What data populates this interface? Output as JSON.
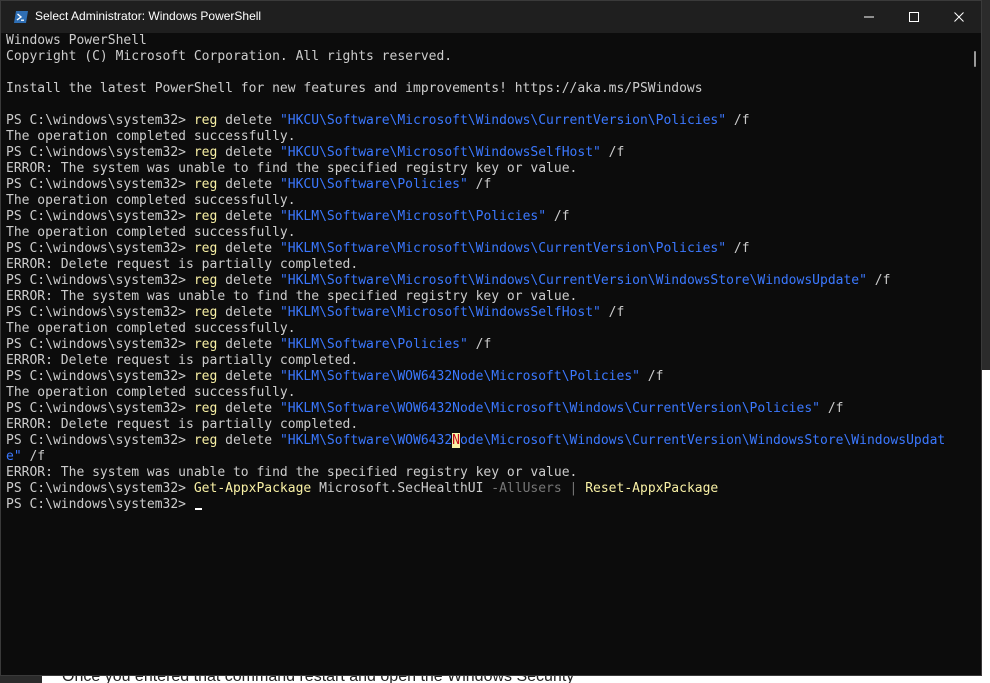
{
  "background": {
    "bottom_text": "Once you entered that command restart and open the Windows Security"
  },
  "window": {
    "title": "Select Administrator: Windows PowerShell",
    "controls": {
      "minimize": "minimize-icon",
      "maximize": "maximize-icon",
      "close": "close-icon"
    }
  },
  "colors": {
    "background": "#0c0c0c",
    "text": "#cccccc",
    "command": "#f9f1a5",
    "string": "#3b78ff",
    "parameter": "#767676"
  },
  "terminal": {
    "header": [
      "Windows PowerShell",
      "Copyright (C) Microsoft Corporation. All rights reserved.",
      "",
      "Install the latest PowerShell for new features and improvements! https://aka.ms/PSWindows",
      ""
    ],
    "prompt": "PS C:\\windows\\system32> ",
    "entries": [
      {
        "cmd": "reg",
        "arg": " delete ",
        "str": "\"HKCU\\Software\\Microsoft\\Windows\\CurrentVersion\\Policies\"",
        "tail": " /f",
        "output": "The operation completed successfully."
      },
      {
        "cmd": "reg",
        "arg": " delete ",
        "str": "\"HKCU\\Software\\Microsoft\\WindowsSelfHost\"",
        "tail": " /f",
        "output": "ERROR: The system was unable to find the specified registry key or value."
      },
      {
        "cmd": "reg",
        "arg": " delete ",
        "str": "\"HKCU\\Software\\Policies\"",
        "tail": " /f",
        "output": "The operation completed successfully."
      },
      {
        "cmd": "reg",
        "arg": " delete ",
        "str": "\"HKLM\\Software\\Microsoft\\Policies\"",
        "tail": " /f",
        "output": "The operation completed successfully."
      },
      {
        "cmd": "reg",
        "arg": " delete ",
        "str": "\"HKLM\\Software\\Microsoft\\Windows\\CurrentVersion\\Policies\"",
        "tail": " /f",
        "output": "ERROR: Delete request is partially completed."
      },
      {
        "cmd": "reg",
        "arg": " delete ",
        "str": "\"HKLM\\Software\\Microsoft\\Windows\\CurrentVersion\\WindowsStore\\WindowsUpdate\"",
        "tail": " /f",
        "output": "ERROR: The system was unable to find the specified registry key or value."
      },
      {
        "cmd": "reg",
        "arg": " delete ",
        "str": "\"HKLM\\Software\\Microsoft\\WindowsSelfHost\"",
        "tail": " /f",
        "output": "The operation completed successfully."
      },
      {
        "cmd": "reg",
        "arg": " delete ",
        "str": "\"HKLM\\Software\\Policies\"",
        "tail": " /f",
        "output": "ERROR: Delete request is partially completed."
      },
      {
        "cmd": "reg",
        "arg": " delete ",
        "str": "\"HKLM\\Software\\WOW6432Node\\Microsoft\\Policies\"",
        "tail": " /f",
        "output": "The operation completed successfully."
      },
      {
        "cmd": "reg",
        "arg": " delete ",
        "str": "\"HKLM\\Software\\WOW6432Node\\Microsoft\\Windows\\CurrentVersion\\Policies\"",
        "tail": " /f",
        "output": "ERROR: Delete request is partially completed."
      }
    ],
    "wrapped_entry": {
      "cmd": "reg",
      "arg": " delete ",
      "str_before_cursor": "\"HKLM\\Software\\WOW6432",
      "cursor_char": "N",
      "str_after_cursor": "ode\\Microsoft\\Windows\\CurrentVersion\\WindowsStore\\WindowsUpdat",
      "wrap_str": "e\"",
      "wrap_tail": " /f",
      "output": "ERROR: The system was unable to find the specified registry key or value."
    },
    "appx_entry": {
      "cmd1": "Get-AppxPackage",
      "arg": " Microsoft.SecHealthUI ",
      "param": "-AllUsers",
      "pipe": " | ",
      "cmd2": "Reset-AppxPackage"
    },
    "final_prompt": "PS C:\\windows\\system32> "
  }
}
